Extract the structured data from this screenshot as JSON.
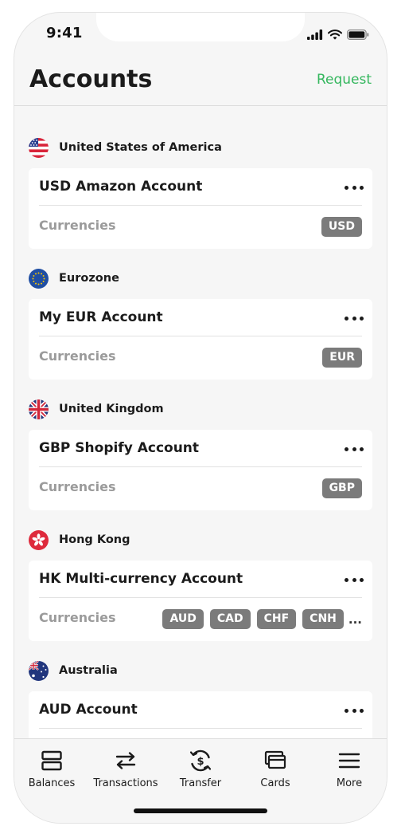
{
  "status_bar": {
    "time": "9:41",
    "icons": [
      "cellular-signal-icon",
      "wifi-icon",
      "battery-icon"
    ]
  },
  "header": {
    "title": "Accounts",
    "request_label": "Request",
    "accent_color": "#35b75e"
  },
  "currencies_label": "Currencies",
  "regions": [
    {
      "name": "United States of America",
      "flag": "us-flag-icon",
      "account": {
        "name": "USD Amazon Account",
        "currencies": [
          "USD"
        ],
        "more_indicator": ""
      }
    },
    {
      "name": "Eurozone",
      "flag": "eu-flag-icon",
      "account": {
        "name": "My EUR Account",
        "currencies": [
          "EUR"
        ],
        "more_indicator": ""
      }
    },
    {
      "name": "United Kingdom",
      "flag": "uk-flag-icon",
      "account": {
        "name": "GBP Shopify Account",
        "currencies": [
          "GBP"
        ],
        "more_indicator": ""
      }
    },
    {
      "name": "Hong Kong",
      "flag": "hk-flag-icon",
      "account": {
        "name": "HK Multi-currency Account",
        "currencies": [
          "AUD",
          "CAD",
          "CHF",
          "CNH"
        ],
        "more_indicator": "..."
      }
    },
    {
      "name": "Australia",
      "flag": "au-flag-icon",
      "account": {
        "name": "AUD Account",
        "currencies": [],
        "more_indicator": ""
      }
    }
  ],
  "tabbar": {
    "tabs": [
      {
        "label": "Balances",
        "icon": "balances-icon"
      },
      {
        "label": "Transactions",
        "icon": "transactions-icon"
      },
      {
        "label": "Transfer",
        "icon": "transfer-icon"
      },
      {
        "label": "Cards",
        "icon": "cards-icon"
      },
      {
        "label": "More",
        "icon": "menu-icon"
      }
    ]
  }
}
